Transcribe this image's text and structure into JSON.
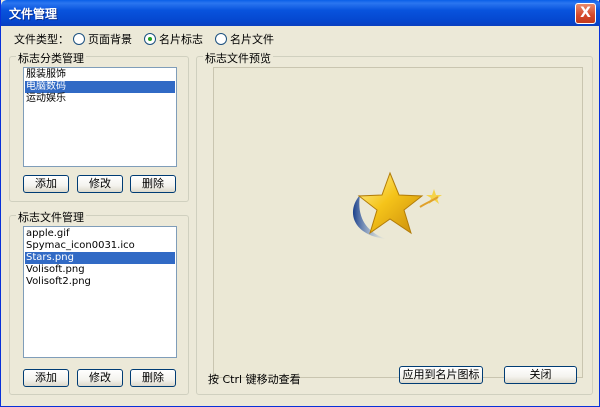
{
  "window": {
    "title": "文件管理",
    "close_label": "X"
  },
  "file_type": {
    "label": "文件类型：",
    "options": [
      {
        "label": "页面背景",
        "selected": false
      },
      {
        "label": "名片标志",
        "selected": true
      },
      {
        "label": "名片文件",
        "selected": false
      }
    ]
  },
  "category_group": {
    "title": "标志分类管理",
    "items": [
      "服装服饰",
      "电脑数码",
      "运动娱乐"
    ],
    "selected_index": 1,
    "buttons": {
      "add": "添加",
      "edit": "修改",
      "delete": "删除"
    }
  },
  "file_group": {
    "title": "标志文件管理",
    "items": [
      "apple.gif",
      "Spymac_icon0031.ico",
      "Stars.png",
      "Volisoft.png",
      "Volisoft2.png"
    ],
    "selected_index": 2,
    "buttons": {
      "add": "添加",
      "edit": "修改",
      "delete": "删除"
    }
  },
  "preview_group": {
    "title": "标志文件预览",
    "image_icon": "star-logo-icon",
    "hint": "按 Ctrl 键移动查看",
    "apply_button": "应用到名片图标",
    "close_button": "关闭"
  },
  "colors": {
    "title_bar": "#0853dd",
    "window_bg": "#ece9d8",
    "selection": "#316ac5",
    "star_gold": "#f2c21a"
  }
}
